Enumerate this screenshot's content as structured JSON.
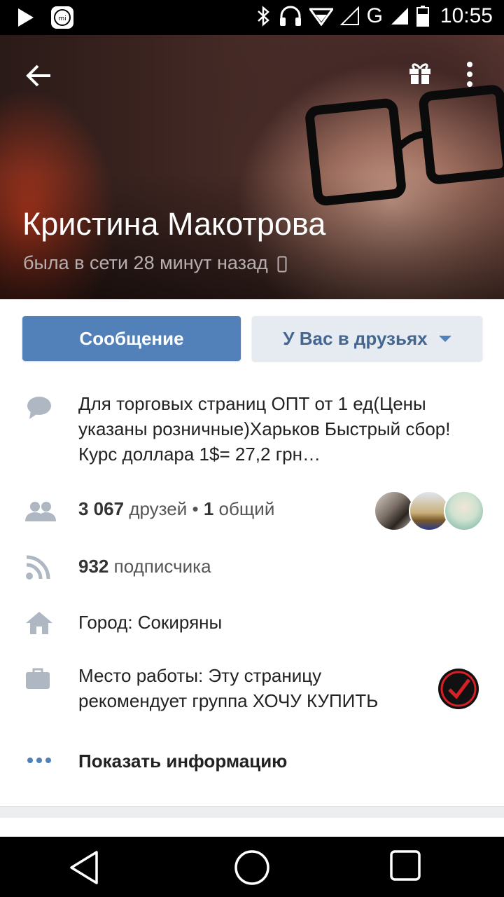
{
  "status_bar": {
    "time": "10:55",
    "network": "G",
    "icons": [
      "play-icon",
      "mi-icon",
      "bluetooth-icon",
      "headset-icon",
      "wifi-icon",
      "signal-icon",
      "battery-icon"
    ]
  },
  "header": {
    "back_icon": "arrow-left-icon",
    "gift_icon": "gift-icon",
    "more_icon": "more-vertical-icon"
  },
  "profile": {
    "name": "Кристина Макотрова",
    "last_seen": "была в сети 28 минут назад"
  },
  "actions": {
    "message_label": "Сообщение",
    "friends_label": "У Вас в друзьях"
  },
  "info": {
    "status": "Для торговых страниц ОПТ от 1 ед(Цены указаны розничные)Харьков Быстрый сбор!Курс доллара 1$= 27,2 грн…",
    "friends_count": "3 067",
    "friends_word": "друзей",
    "separator": "•",
    "mutual_count": "1",
    "mutual_word": "общий",
    "followers_count": "932",
    "followers_word": "подписчика",
    "city": "Город: Сокиряны",
    "work_line1": "Место работы: Эту страницу",
    "work_line2": "рекомендует группа ХОЧУ КУПИТЬ",
    "show_info_label": "Показать информацию"
  },
  "colors": {
    "accent": "#5181b8",
    "secondary_button_bg": "#e5ebf1",
    "icon_gray": "#aeb7c2"
  }
}
